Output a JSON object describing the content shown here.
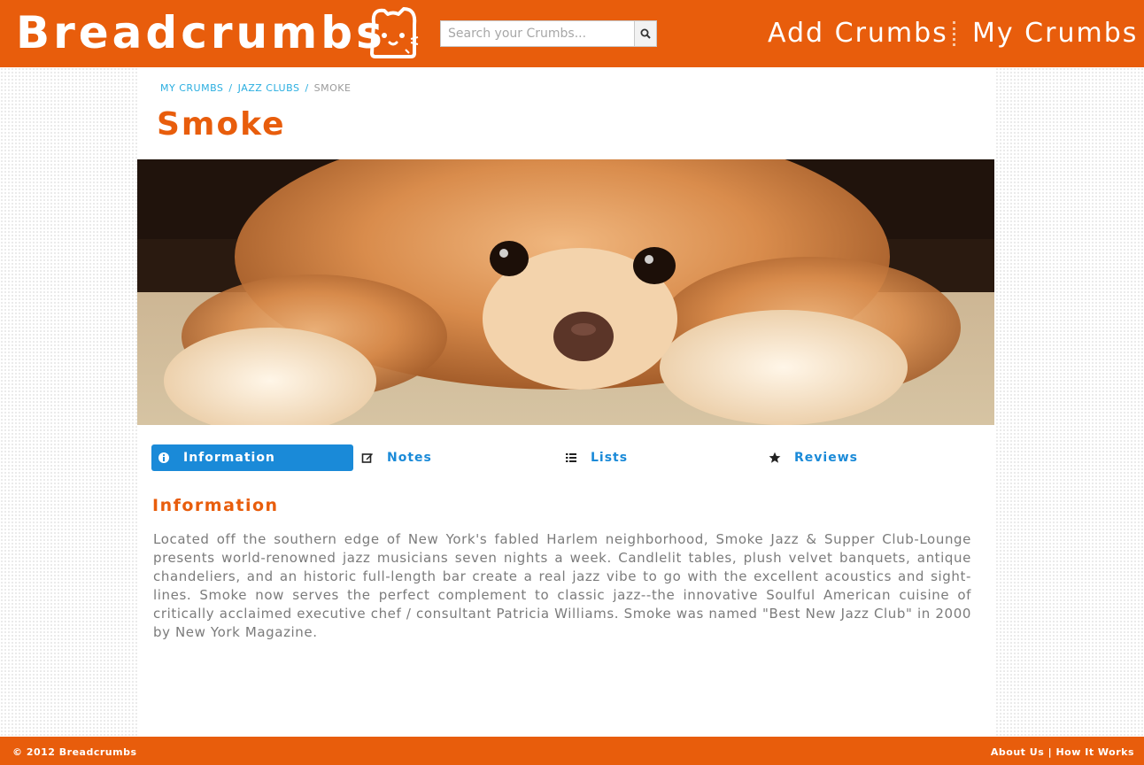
{
  "header": {
    "logo_text": "Breadcrumbs",
    "search": {
      "placeholder": "Search your Crumbs..."
    },
    "nav": {
      "add_crumbs": "Add Crumbs",
      "my_crumbs": "My Crumbs"
    }
  },
  "breadcrumb": {
    "items": [
      "MY CRUMBS",
      "JAZZ CLUBS"
    ],
    "separator": "/",
    "current": "SMOKE"
  },
  "page": {
    "title": "Smoke",
    "hero_image": "pomeranian-dog-photo"
  },
  "tabs": [
    {
      "label": "Information",
      "icon": "info-circle-icon",
      "active": true
    },
    {
      "label": "Notes",
      "icon": "edit-icon",
      "active": false
    },
    {
      "label": "Lists",
      "icon": "list-icon",
      "active": false
    },
    {
      "label": "Reviews",
      "icon": "star-icon",
      "active": false
    }
  ],
  "information": {
    "heading": "Information",
    "body": "Located off the southern edge of New York's fabled Harlem neighborhood, Smoke Jazz & Supper Club-Lounge presents world-renowned jazz musicians seven nights a week. Candlelit tables, plush velvet banquets, antique chandeliers, and an historic full-length bar create a real jazz vibe to go with the excellent acoustics and sight-lines. Smoke now serves the perfect complement to classic jazz--the innovative Soulful American cuisine of critically acclaimed executive chef / consultant Patricia Williams. Smoke was named \"Best New Jazz Club\" in 2000 by New York Magazine."
  },
  "footer": {
    "copyright": "© 2012 Breadcrumbs",
    "about": "About Us",
    "separator": "|",
    "how": "How It Works"
  },
  "colors": {
    "brand_orange": "#e85d0c",
    "accent_blue": "#1a8ad8",
    "link_blue": "#2aaee0"
  }
}
